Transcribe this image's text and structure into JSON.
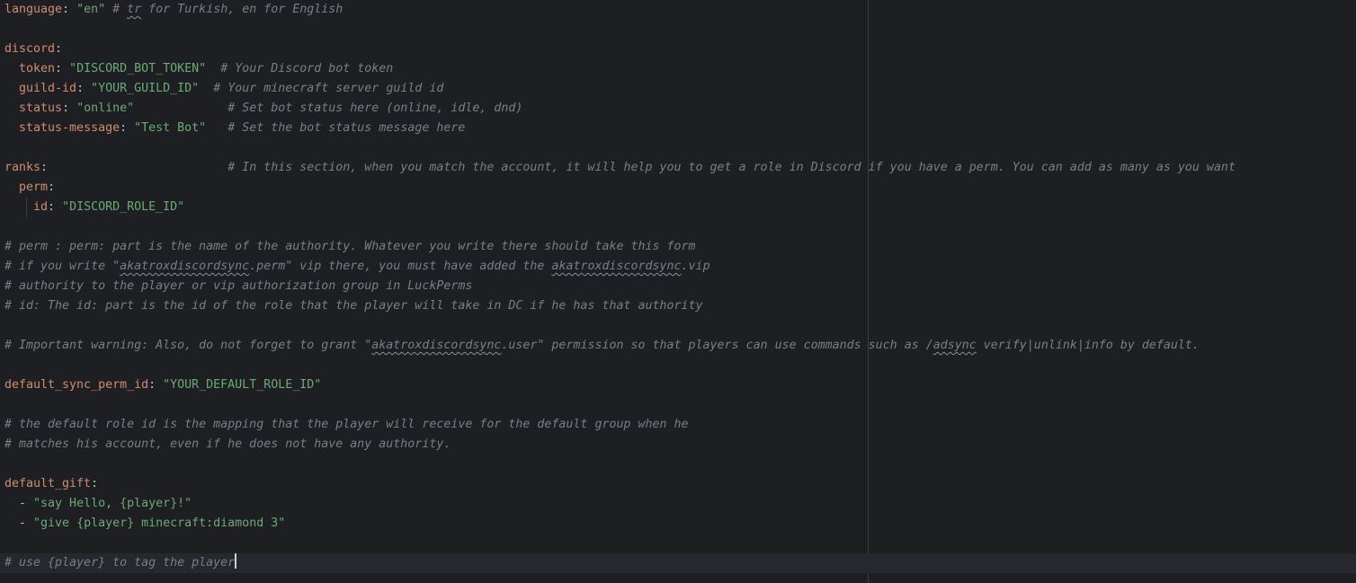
{
  "editor": {
    "l1": {
      "key": "language",
      "value": "\"en\"",
      "comment_pre": "# ",
      "comment_typo": "tr",
      "comment_post": " for Turkish, en for English"
    },
    "l3": {
      "key": "discord"
    },
    "l4": {
      "key": "token",
      "value": "\"DISCORD_BOT_TOKEN\"",
      "comment": "# Your Discord bot token"
    },
    "l5": {
      "key": "guild-id",
      "value": "\"YOUR_GUILD_ID\"",
      "comment": "# Your minecraft server guild id"
    },
    "l6": {
      "key": "status",
      "value": "\"online\"",
      "comment": "# Set bot status here (online, idle, dnd)"
    },
    "l7": {
      "key": "status-message",
      "value": "\"Test Bot\"",
      "comment": "# Set the bot status message here"
    },
    "l9": {
      "key": "ranks",
      "comment": "# In this section, when you match the account, it will help you to get a role in Discord if you have a perm. You can add as many as you want"
    },
    "l10": {
      "key": "perm"
    },
    "l11": {
      "key": "id",
      "value": "\"DISCORD_ROLE_ID\""
    },
    "l13": {
      "comment": "# perm : perm: part is the name of the authority. Whatever you write there should take this form"
    },
    "l14": {
      "pre": "# if you write \"",
      "typo1": "akatroxdiscordsync",
      "mid": ".perm\" vip there, you must have added the ",
      "typo2": "akatroxdiscordsync",
      "post": ".vip"
    },
    "l15": {
      "comment": "# authority to the player or vip authorization group in LuckPerms"
    },
    "l16": {
      "comment": "# id: The id: part is the id of the role that the player will take in DC if he has that authority"
    },
    "l18": {
      "pre": "# Important warning: Also, do not forget to grant \"",
      "typo1": "akatroxdiscordsync",
      "mid": ".user\" permission so that players can use commands such as /",
      "typo2": "adsync",
      "post": " verify|unlink|info by default."
    },
    "l20": {
      "key": "default_sync_perm_id",
      "value": "\"YOUR_DEFAULT_ROLE_ID\""
    },
    "l22": {
      "comment": "# the default role id is the mapping that the player will receive for the default group when he"
    },
    "l23": {
      "comment": "# matches his account, even if he does not have any authority."
    },
    "l25": {
      "key": "default_gift"
    },
    "l26": {
      "dash": "- ",
      "value": "\"say Hello, {player}!\""
    },
    "l27": {
      "dash": "- ",
      "value": "\"give {player} minecraft:diamond 3\""
    },
    "l29": {
      "comment": "# use {player} to tag the player"
    }
  },
  "colors": {
    "background": "#1e1f22",
    "key": "#cf8e6d",
    "string": "#6aab73",
    "comment": "#7a7e85",
    "text": "#bcbec4",
    "current_line": "#26282e"
  }
}
